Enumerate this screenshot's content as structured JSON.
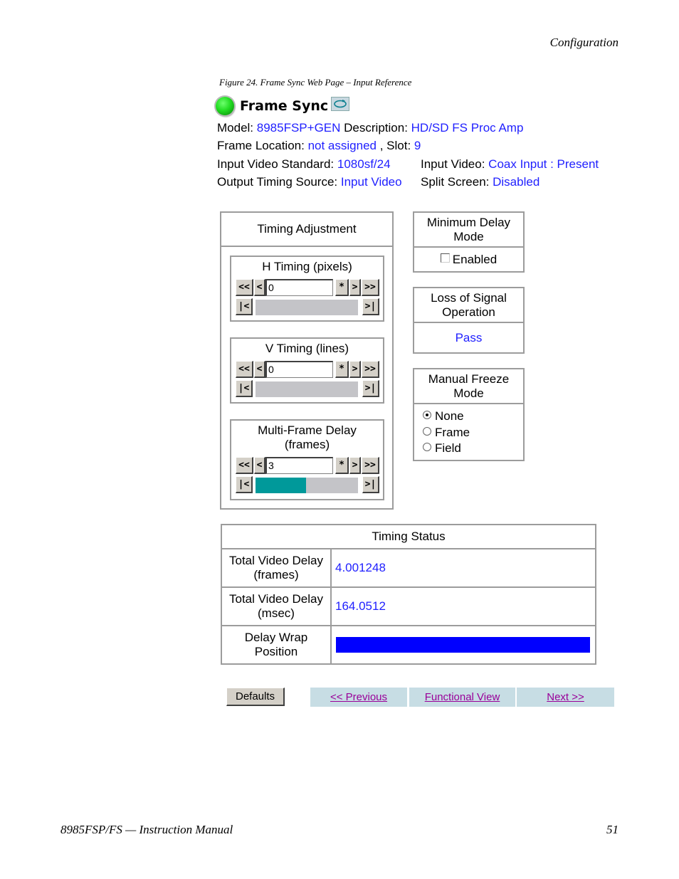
{
  "page": {
    "section_header": "Configuration",
    "figure_caption": "Figure 24.  Frame Sync Web Page – Input Reference",
    "footer_left": "8985FSP/FS — Instruction Manual",
    "page_number": "51"
  },
  "header": {
    "status_icon": "green-status-led",
    "title": "Frame Sync",
    "refresh_icon": "refresh-icon"
  },
  "info": {
    "model_label": "Model:",
    "model_value": "8985FSP+GEN",
    "description_label": "Description:",
    "description_value": "HD/SD FS Proc Amp",
    "frame_location_label": "Frame Location:",
    "frame_location_value": "not assigned",
    "slot_label": ", Slot:",
    "slot_value": "9",
    "input_standard_label": "Input Video Standard:",
    "input_standard_value": "1080sf/24",
    "input_video_label": "Input Video:",
    "input_video_value": "Coax Input : Present",
    "output_timing_label": "Output Timing Source:",
    "output_timing_value": "Input Video",
    "split_screen_label": "Split Screen:",
    "split_screen_value": "Disabled"
  },
  "timing_adjustment": {
    "title": "Timing Adjustment",
    "buttons": {
      "first": "<<",
      "prev": "<",
      "default": "*",
      "next": ">",
      "last": ">>",
      "min": "|<",
      "max": ">|"
    },
    "h_timing": {
      "label": "H Timing (pixels)",
      "value": "0",
      "slider_fraction": 0
    },
    "v_timing": {
      "label": "V Timing (lines)",
      "value": "0",
      "slider_fraction": 0
    },
    "multi_frame": {
      "label_line1": "Multi-Frame Delay",
      "label_line2": "(frames)",
      "value": "3",
      "slider_fraction": 0.5
    }
  },
  "minimum_delay": {
    "title_line1": "Minimum Delay",
    "title_line2": "Mode",
    "checkbox_label": "Enabled",
    "checked": false
  },
  "loss_of_signal": {
    "title_line1": "Loss of Signal",
    "title_line2": "Operation",
    "value": "Pass"
  },
  "manual_freeze": {
    "title_line1": "Manual Freeze",
    "title_line2": "Mode",
    "options": [
      "None",
      "Frame",
      "Field"
    ],
    "selected": "None"
  },
  "timing_status": {
    "title": "Timing Status",
    "rows": [
      {
        "label_line1": "Total Video Delay",
        "label_line2": "(frames)",
        "value": "4.001248"
      },
      {
        "label_line1": "Total Video Delay",
        "label_line2": "(msec)",
        "value": "164.0512"
      },
      {
        "label_line1": "Delay Wrap",
        "label_line2": "Position",
        "bar_fraction": 1.0,
        "bar_color": "#0000ff"
      }
    ]
  },
  "footer_nav": {
    "defaults_label": "Defaults",
    "previous_label": "<< Previous",
    "functional_view_label": "Functional View",
    "next_label": "Next >>"
  },
  "colors": {
    "value_text": "#1f1fff",
    "slider_fill": "#00999a",
    "link": "#990099",
    "nav_bg": "#c7dde4"
  }
}
